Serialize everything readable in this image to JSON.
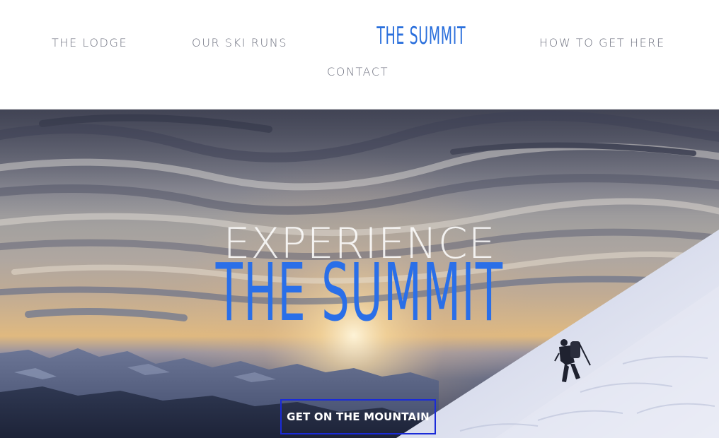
{
  "header": {
    "logo_text": "THE SUMMIT",
    "nav": {
      "lodge": "THE LODGE",
      "ski_runs": "OUR SKI RUNS",
      "getting_here": "HOW TO GET HERE",
      "contact": "CONTACT"
    }
  },
  "hero": {
    "kicker": "EXPERIENCE",
    "title": "THE SUMMIT",
    "cta_label": "GET ON THE MOUNTAIN"
  },
  "colors": {
    "brand_blue": "#2a6fe8",
    "nav_text": "#6f7280",
    "cta_border": "#1a2bd8"
  },
  "icons": {
    "hero_image": "mountain-hiker-sunset-photo"
  }
}
